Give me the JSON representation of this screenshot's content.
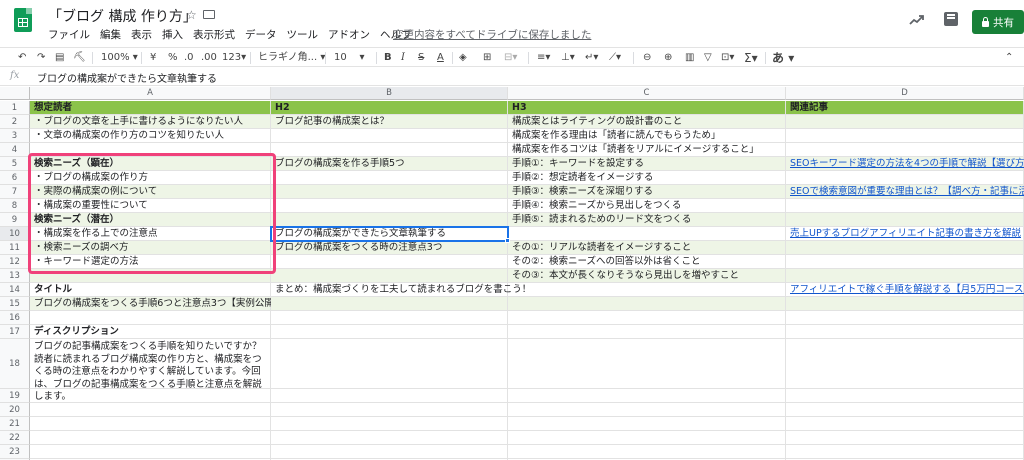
{
  "app": {
    "title": "「ブログ 構成 作り方」",
    "menu": [
      "ファイル",
      "編集",
      "表示",
      "挿入",
      "表示形式",
      "データ",
      "ツール",
      "アドオン",
      "ヘルプ"
    ],
    "save_status": "変更内容をすべてドライブに保存しました",
    "share_label": "共有"
  },
  "toolbar": {
    "zoom": "100%",
    "currency": "¥",
    "percent": "%",
    "dec_less": ".0",
    "dec_more": ".00",
    "format": "123",
    "font": "ヒラギノ角...",
    "font_size": "10",
    "bold": "B",
    "italic": "I",
    "strike": "S",
    "text_color": "A",
    "sum": "Σ",
    "input_tool": "あ"
  },
  "formula_bar": {
    "fx": "fx",
    "content": "ブログの構成案ができたら文章執筆する"
  },
  "columns": [
    "A",
    "B",
    "C",
    "D"
  ],
  "rows": [
    [
      "想定読者",
      "H2",
      "H3",
      "関連記事"
    ],
    [
      "・ブログの文章を上手に書けるようになりたい人",
      "ブログ記事の構成案とは？",
      "構成案とはライティングの設計書のこと",
      ""
    ],
    [
      "・文章の構成案の作り方のコツを知りたい人",
      "",
      "構成案を作る理由は「読者に読んでもらうため」",
      ""
    ],
    [
      "",
      "",
      "構成案を作るコツは「読者をリアルにイメージすること」",
      ""
    ],
    [
      "検索ニーズ（顕在）",
      "ブログの構成案を作る手順5つ",
      "手順①：キーワードを設定する",
      "SEOキーワード選定の方法を4つの手順で解説【選び方のコ"
    ],
    [
      "・ブログの構成案の作り方",
      "",
      "手順②：想定読者をイメージする",
      ""
    ],
    [
      "・実際の構成案の例について",
      "",
      "手順③：検索ニーズを深堀りする",
      "SEOで検索意図が重要な理由とは？【調べ方・記事に活かす"
    ],
    [
      "・構成案の重要性について",
      "",
      "手順④：検索ニーズから見出しをつくる",
      ""
    ],
    [
      "検索ニーズ（潜在）",
      "",
      "手順⑤：読まれるためのリード文をつくる",
      ""
    ],
    [
      "・構成案を作る上での注意点",
      "ブログの構成案ができたら文章執筆する",
      "",
      "売上UPするブログアフィリエイト記事の書き方を解説"
    ],
    [
      "・検索ニーズの調べ方",
      "ブログの構成案をつくる時の注意点3つ",
      "その①：リアルな読者をイメージすること",
      ""
    ],
    [
      "・キーワード選定の方法",
      "",
      "その②：検索ニーズへの回答以外は省くこと",
      ""
    ],
    [
      "",
      "",
      "その③：本文が長くなりそうなら見出しを増やすこと",
      ""
    ],
    [
      "タイトル",
      "まとめ：構成案づくりを工夫して読まれるブログを書こう！",
      "",
      "アフィリエイトで稼ぐ手順を解説する【月5万円コース】"
    ],
    [
      "ブログの構成案をつくる手順6つと注意点3つ【実例公開】",
      "",
      "",
      ""
    ],
    [
      "",
      "",
      "",
      ""
    ],
    [
      "ディスクリプション",
      "",
      "",
      ""
    ],
    [
      "ブログの記事構成案をつくる手順を知りたいですか？読者に読まれるブログ構成案の作り方と、構成案をつくる時の注意点をわかりやすく解説しています。今回は、ブログの記事構成案をつくる手順と注意点を解説します。",
      "",
      "",
      ""
    ],
    [
      "",
      "",
      "",
      ""
    ],
    [
      "",
      "",
      "",
      ""
    ],
    [
      "",
      "",
      "",
      ""
    ],
    [
      "",
      "",
      "",
      ""
    ],
    [
      "",
      "",
      "",
      ""
    ],
    [
      "",
      "",
      "",
      ""
    ]
  ],
  "colors": {
    "header_green": "#8bc34a",
    "band_green": "#eef5e6",
    "highlight": "#f0417a",
    "selection": "#1a73e8",
    "share_button": "#188038"
  }
}
